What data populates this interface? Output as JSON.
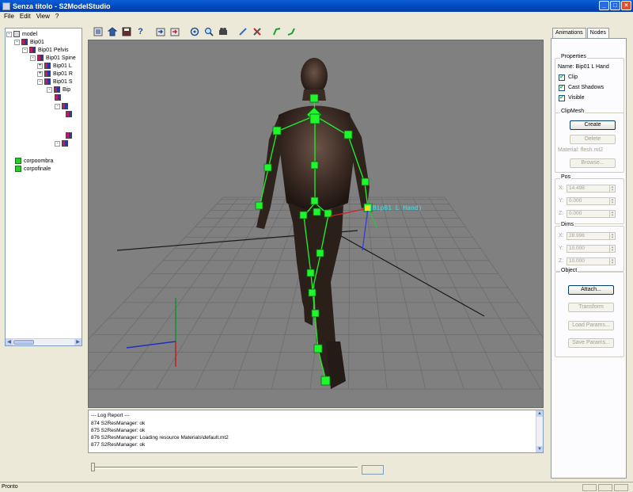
{
  "window": {
    "title": "Senza titolo - S2ModelStudio",
    "controls": [
      "_",
      "□",
      "×"
    ]
  },
  "menu": [
    "File",
    "Edit",
    "View",
    "?"
  ],
  "tree": {
    "items": [
      {
        "label": "model",
        "icon": "model",
        "expander": "-"
      },
      {
        "label": "Bip01",
        "icon": "bone",
        "expander": "-"
      },
      {
        "label": "Bip01 Pelvis",
        "icon": "bone",
        "expander": "-"
      },
      {
        "label": "Bip01 Spine",
        "icon": "bone",
        "expander": "-"
      },
      {
        "label": "Bip01 L",
        "icon": "bone",
        "expander": "+"
      },
      {
        "label": "Bip01 R",
        "icon": "bone",
        "expander": "+"
      },
      {
        "label": "Bip01 S",
        "icon": "bone",
        "expander": "-"
      },
      {
        "label": "Bip",
        "icon": "bone",
        "expander": "-"
      },
      {
        "label": "",
        "icon": "bone",
        "expander": ""
      },
      {
        "label": "",
        "icon": "bone",
        "expander": "-"
      },
      {
        "label": "",
        "icon": "bone",
        "expander": ""
      },
      {
        "label": "",
        "icon": "bone",
        "expander": ""
      },
      {
        "label": "",
        "icon": "bone",
        "expander": "-"
      },
      {
        "label": "corpoombra",
        "icon": "mesh",
        "expander": ""
      },
      {
        "label": "corpofinale",
        "icon": "mesh",
        "expander": ""
      }
    ]
  },
  "toolbar": {
    "buttons": [
      "new-model-icon",
      "open-icon",
      "save-icon",
      "help-icon",
      "import-icon",
      "export-icon",
      "rotate-view-icon",
      "zoom-icon",
      "camera-pan-icon",
      "bone-tool-icon",
      "delete-tool-icon",
      "bone-green-icon",
      "bone-link-icon"
    ]
  },
  "viewport": {
    "selected_bone_label": "(Bip01 L Hand)"
  },
  "log": {
    "lines": [
      "--- Log Report ---",
      "874 S2ResManager: ok",
      "875 S2ResManager: ok",
      "876 S2ResManager: Loading resource Materials\\default.mt2",
      "877 S2ResManager: ok"
    ]
  },
  "timeline": {
    "position": 0
  },
  "panel": {
    "tabs": [
      "Animations",
      "Nodes"
    ],
    "active_tab": "Nodes",
    "properties": {
      "title": "Properties",
      "name": "Name: Bip01 L Hand",
      "clip_label": "Clip",
      "cast_shadows_label": "Cast Shadows",
      "visible_label": "Visible",
      "clip": true,
      "cast_shadows": true,
      "visible": true
    },
    "clipmesh": {
      "title": "ClipMesh",
      "create": "Create",
      "delete": "Delete",
      "material": "Material: flesh.mt2",
      "browse": "Browse..."
    },
    "pos": {
      "title": "Pos",
      "x_label": "X:",
      "y_label": "Y:",
      "z_label": "Z:",
      "x": "14.498",
      "y": "0.000",
      "z": "0.000"
    },
    "dims": {
      "title": "Dims",
      "x_label": "X:",
      "y_label": "Y:",
      "z_label": "Z:",
      "x": "28.996",
      "y": "10.000",
      "z": "10.000"
    },
    "object": {
      "title": "Object",
      "attach": "Attach...",
      "transform": "Transform",
      "load_params": "Load Params...",
      "save_params": "Save Params..."
    }
  },
  "status": {
    "text": "Pronto"
  }
}
